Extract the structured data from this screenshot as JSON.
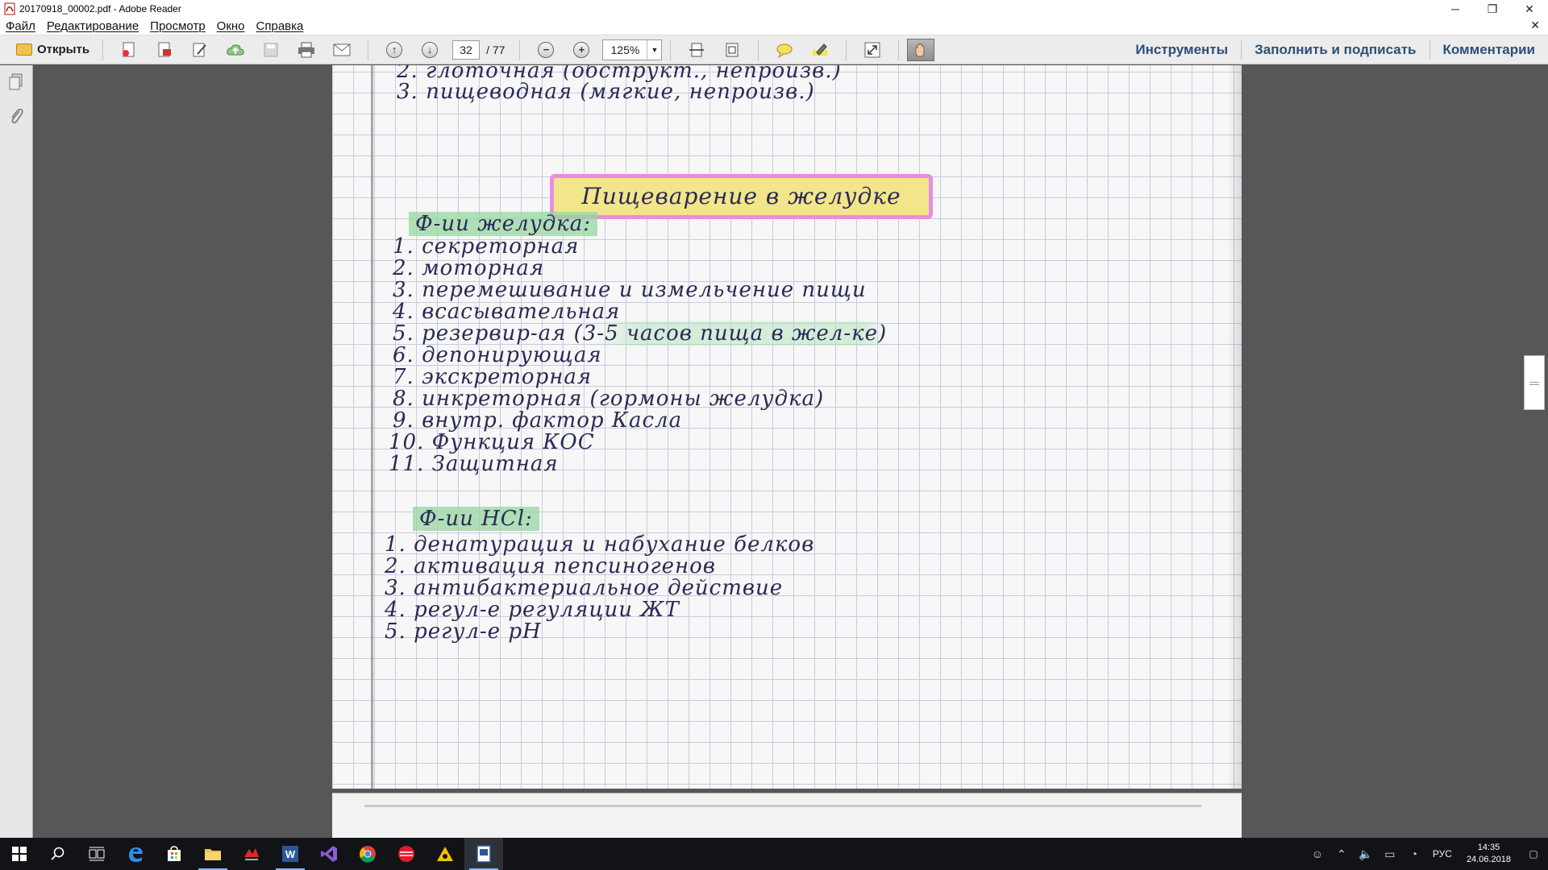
{
  "window": {
    "title": "20170918_00002.pdf - Adobe Reader",
    "controls": {
      "minimize": "─",
      "restore": "❐",
      "close": "✕"
    }
  },
  "menu": {
    "items": [
      "Файл",
      "Редактирование",
      "Просмотр",
      "Окно",
      "Справка"
    ],
    "close_doc": "✕"
  },
  "toolbar": {
    "open_label": "Открыть",
    "page_current": "32",
    "page_total": "/ 77",
    "zoom": "125%",
    "tools_label": "Инструменты",
    "fill_sign_label": "Заполнить и подписать",
    "comments_label": "Комментарии"
  },
  "document": {
    "top_lines": [
      "2. глоточная (обструкт., непроизв.)",
      "3. пищеводная (мягкие, непроизв.)"
    ],
    "heading": "Пищеварение в желудке",
    "section1_title": "Ф-ии желудка:",
    "section1_items": [
      "1. секреторная",
      "2. моторная",
      "3. перемешивание и измельчение пищи",
      "4. всасывательная",
      "5. резервир-ая (3-5 часов пища в жел-ке)",
      "6. депонирующая",
      "7. экскреторная",
      "8. инкреторная (гормоны желудка)",
      "9. внутр. фактор Касла",
      "10. Функция КОС",
      "11. Защитная"
    ],
    "section2_title": "Ф-ии НСl:",
    "section2_items": [
      "1. денатурация и набухание белков",
      "2. активация пепсиногенов",
      "3. антибактериальное действие",
      "4. регул-е регуляции ЖТ",
      "5. регул-е pH"
    ]
  },
  "taskbar": {
    "apps": [
      "start",
      "search",
      "task-view",
      "edge",
      "store",
      "explorer",
      "app-red",
      "word",
      "visual-studio",
      "chrome",
      "opera",
      "app-yellow",
      "adobe-reader"
    ],
    "lang": "РУС",
    "time": "14:35",
    "date": "24.06.2018"
  },
  "colors": {
    "toolbar_link": "#2b4f77",
    "highlight_green": "#96d7a0",
    "highlight_yellow": "#f3e58a",
    "highlight_pink": "#e58fe0"
  }
}
